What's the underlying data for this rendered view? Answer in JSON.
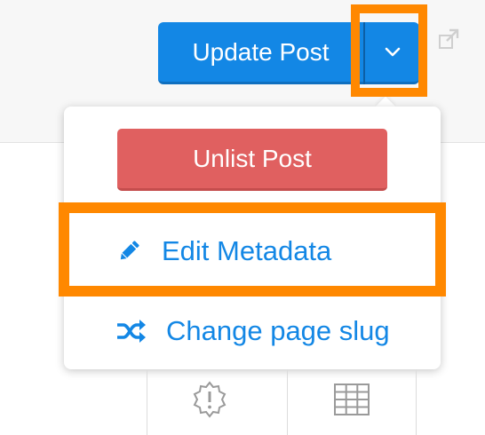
{
  "toolbar": {
    "update_label": "Update Post",
    "toggle_icon": "chevron-down-icon",
    "external_icon": "external-link-icon",
    "primary_color": "#1387e5"
  },
  "dropdown": {
    "unlist_label": "Unlist Post",
    "unlist_color": "#e06060",
    "items": [
      {
        "label": "Edit Metadata",
        "icon": "pencil-icon"
      },
      {
        "label": "Change page slug",
        "icon": "shuffle-icon"
      }
    ]
  },
  "bottom_toolbar": {
    "icons": [
      "alert-badge-icon",
      "table-grid-icon"
    ]
  },
  "highlight_color": "#ff8800"
}
